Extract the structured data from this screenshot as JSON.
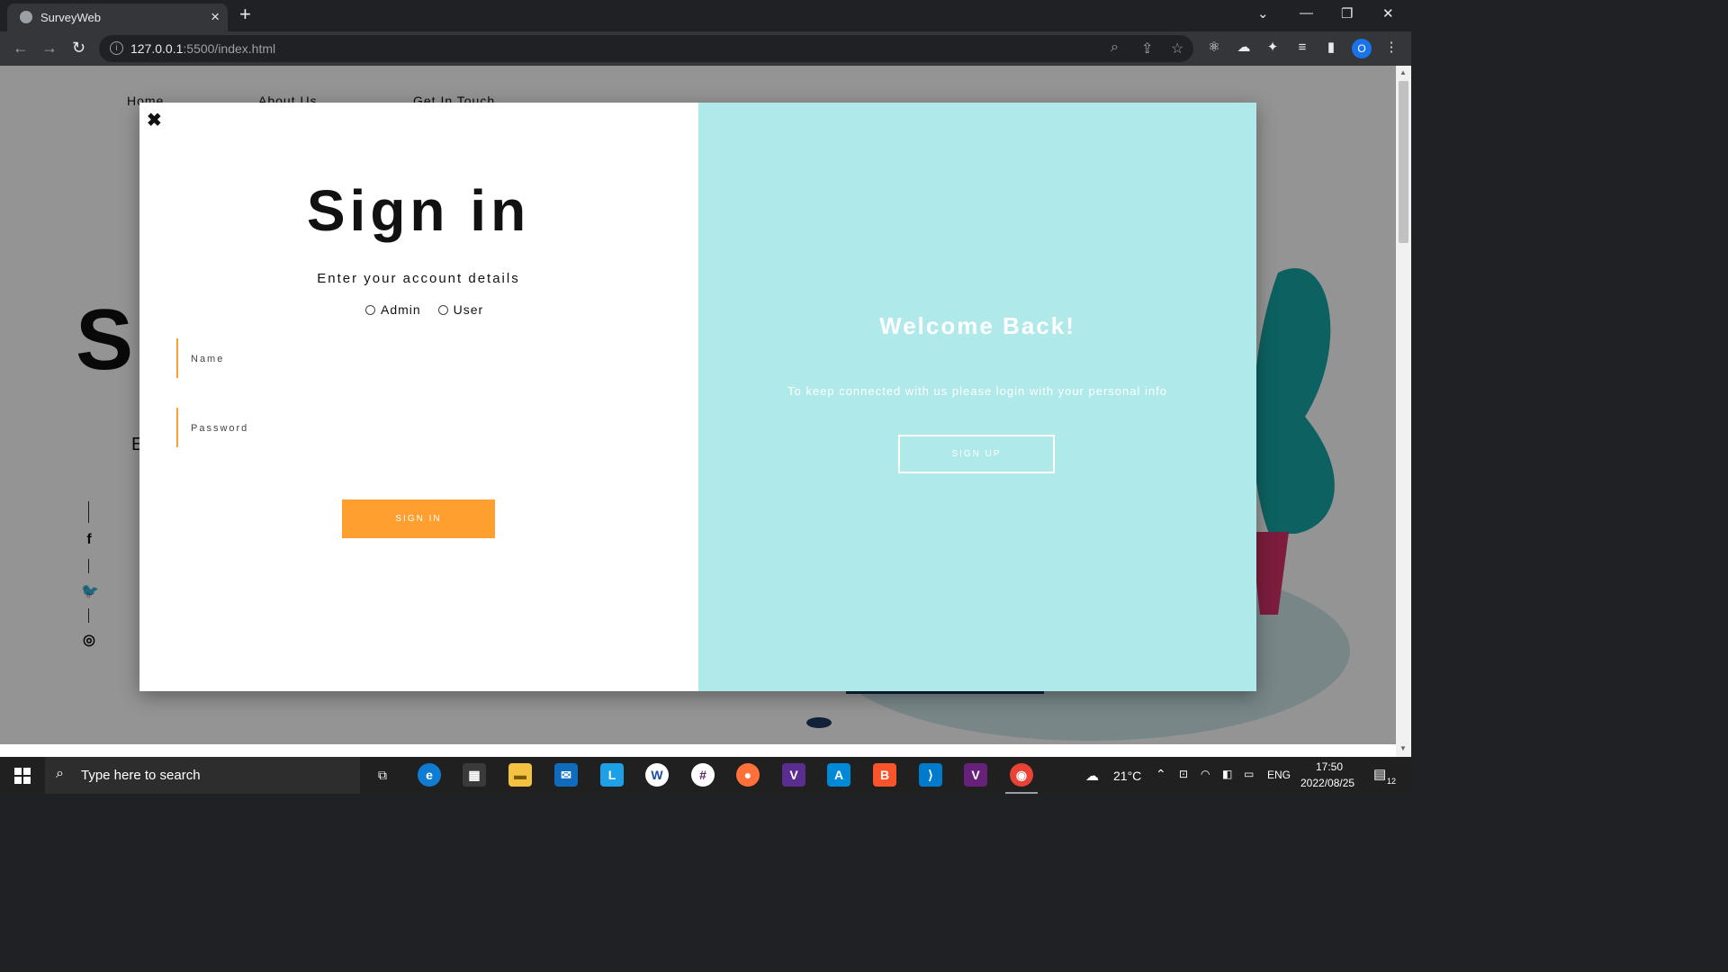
{
  "browser": {
    "tab_title": "SurveyWeb",
    "url_host": "127.0.0.1",
    "url_path": ":5500/index.html",
    "profile_initial": "O"
  },
  "background_page": {
    "nav": [
      "Home",
      "About Us",
      "Get In Touch"
    ],
    "hero_letter": "S",
    "hero_sub_letter": "E"
  },
  "modal": {
    "close_glyph": "✖",
    "title": "Sign in",
    "subtitle": "Enter your account details",
    "roles": [
      "Admin",
      "User"
    ],
    "name_placeholder": "Name",
    "password_placeholder": "Password",
    "signin_label": "SIGN IN",
    "welcome_title": "Welcome Back!",
    "welcome_text": "To keep connected with us please login with your personal info",
    "signup_label": "SIGN UP",
    "colors": {
      "accent": "#ff9f2f",
      "panel": "#afe9e9"
    }
  },
  "taskbar": {
    "search_placeholder": "Type here to search",
    "weather": "21°C",
    "lang": "ENG",
    "time": "17:50",
    "date": "2022/08/25",
    "notifications": "12"
  }
}
